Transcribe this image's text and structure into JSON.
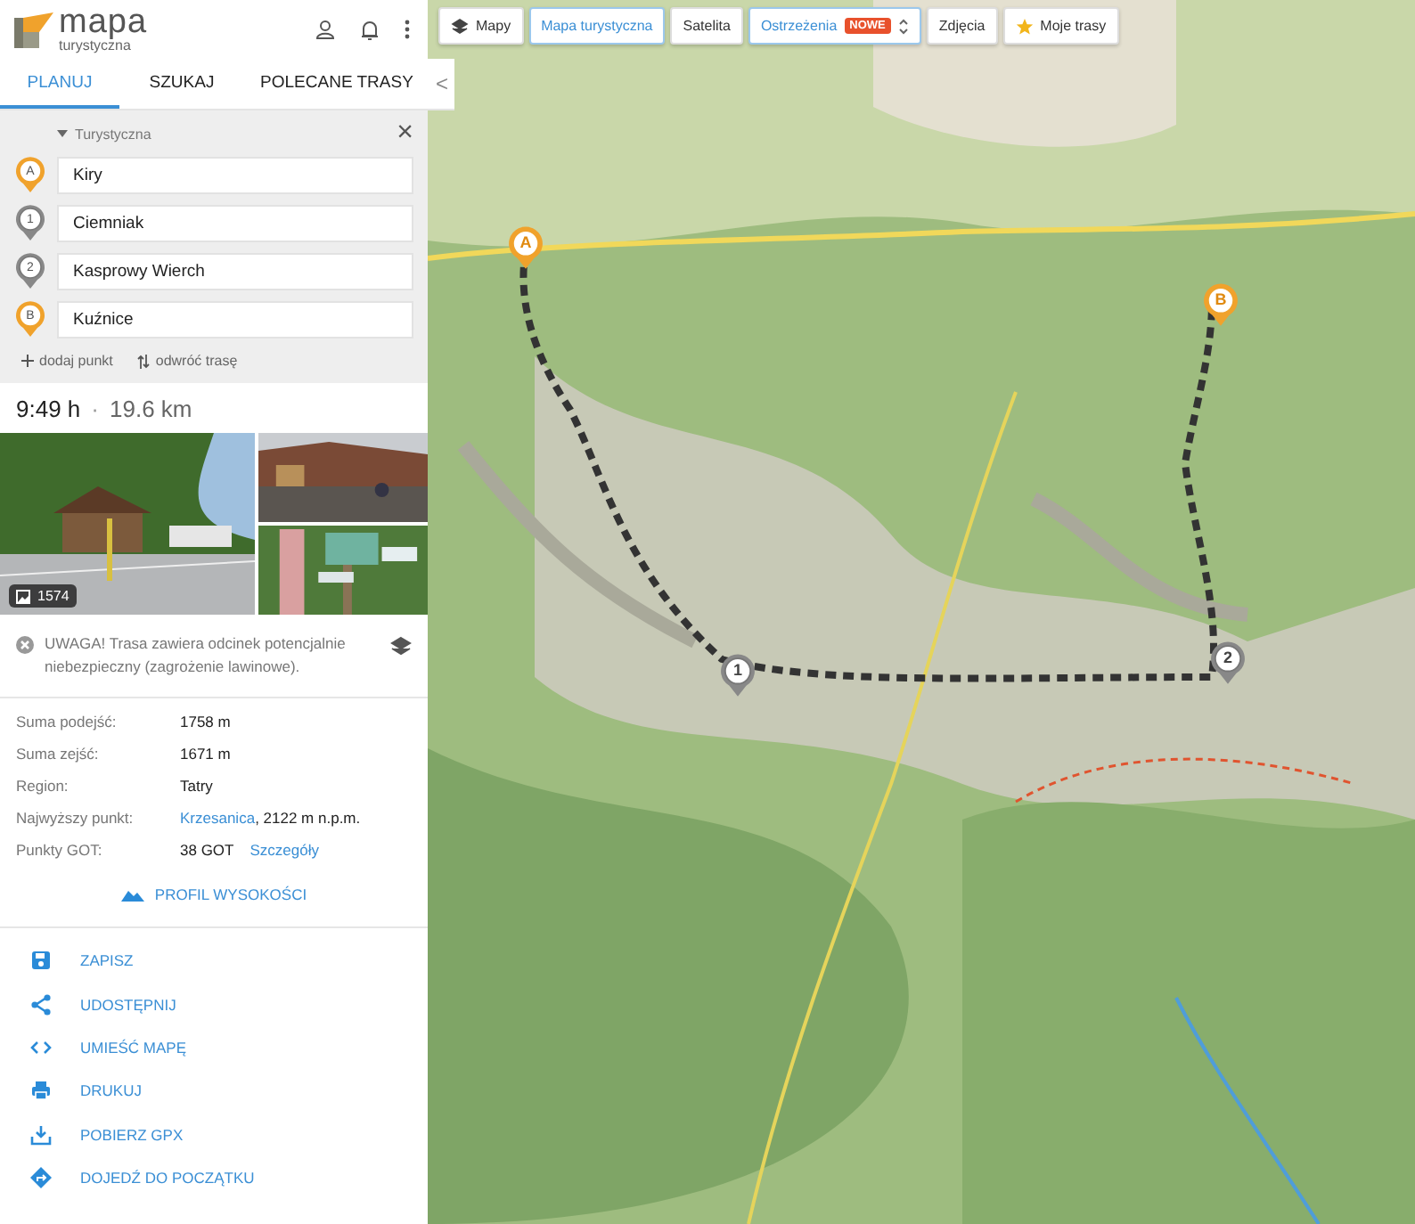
{
  "header": {
    "logo_main": "mapa",
    "logo_sub": "turystyczna"
  },
  "tabs": [
    {
      "label": "PLANUJ",
      "selected": true
    },
    {
      "label": "SZUKAJ",
      "selected": false
    },
    {
      "label": "POLECANE TRASY",
      "selected": false
    }
  ],
  "collapse": "<",
  "planner": {
    "mode": "Turystyczna",
    "close": "×",
    "waypoints": [
      {
        "marker": "A",
        "kind": "end",
        "value": "Kiry"
      },
      {
        "marker": "1",
        "kind": "via",
        "value": "Ciemniak"
      },
      {
        "marker": "2",
        "kind": "via",
        "value": "Kasprowy Wierch"
      },
      {
        "marker": "B",
        "kind": "end",
        "value": "Kuźnice"
      }
    ],
    "add_point": "dodaj punkt",
    "reverse": "odwróć trasę"
  },
  "summary": {
    "time": "9:49 h",
    "separator": "·",
    "distance": "19.6 km"
  },
  "photos": {
    "count": "1574"
  },
  "warning": {
    "text": "UWAGA!  Trasa zawiera odcinek potencjalnie niebezpieczny (zagrożenie lawinowe)."
  },
  "details": [
    {
      "label": "Suma podejść:",
      "parts": [
        {
          "text": "1758 m",
          "link": false
        }
      ]
    },
    {
      "label": "Suma zejść:",
      "parts": [
        {
          "text": "1671 m",
          "link": false
        }
      ]
    },
    {
      "label": "Region:",
      "parts": [
        {
          "text": "Tatry",
          "link": false
        }
      ]
    },
    {
      "label": "Najwyższy punkt:",
      "parts": [
        {
          "text": "Krzesanica",
          "link": true
        },
        {
          "text": ", 2122 m n.p.m.",
          "link": false
        }
      ]
    },
    {
      "label": "Punkty GOT:",
      "parts": [
        {
          "text": "38 GOT",
          "link": false
        },
        {
          "text": "Szczegóły",
          "link": true
        }
      ]
    }
  ],
  "profile": "PROFIL WYSOKOŚCI",
  "actions": [
    {
      "kind": "save",
      "label": "ZAPISZ"
    },
    {
      "kind": "share",
      "label": "UDOSTĘPNIJ"
    },
    {
      "kind": "embed",
      "label": "UMIEŚĆ MAPĘ"
    },
    {
      "kind": "print",
      "label": "DRUKUJ"
    },
    {
      "kind": "download",
      "label": "POBIERZ GPX"
    },
    {
      "kind": "directions",
      "label": "DOJEDŹ DO POCZĄTKU"
    }
  ],
  "map_toolbar": [
    {
      "kind": "layers",
      "label": "Mapy",
      "selected": false
    },
    {
      "kind": "plain",
      "label": "Mapa turystyczna",
      "selected": true
    },
    {
      "kind": "plain",
      "label": "Satelita",
      "selected": false
    },
    {
      "kind": "badge",
      "label": "Ostrzeżenia",
      "badge": "NOWE",
      "selected": true
    },
    {
      "kind": "plain",
      "label": "Zdjęcia",
      "selected": false
    },
    {
      "kind": "star",
      "label": "Moje trasy",
      "selected": false
    }
  ],
  "map": {
    "pins": [
      {
        "label": "A",
        "kind": "end"
      },
      {
        "label": "B",
        "kind": "end"
      },
      {
        "label": "1",
        "kind": "via"
      },
      {
        "label": "2",
        "kind": "via"
      }
    ]
  }
}
